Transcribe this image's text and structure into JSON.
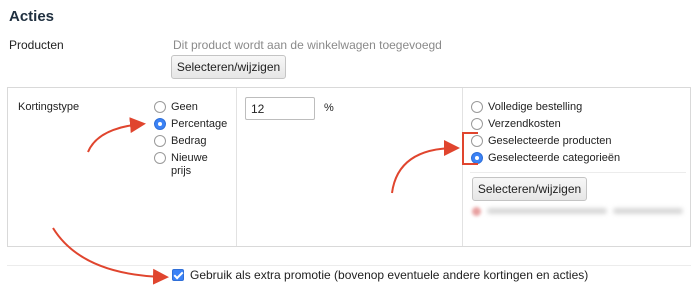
{
  "section_title": "Acties",
  "products": {
    "label": "Producten",
    "note": "Dit product wordt aan de winkelwagen toegevoegd",
    "button_label": "Selecteren/wijzigen"
  },
  "discount": {
    "label": "Kortingstype",
    "type_options": [
      {
        "label": "Geen",
        "checked": false
      },
      {
        "label": "Percentage",
        "checked": true
      },
      {
        "label": "Bedrag",
        "checked": false
      },
      {
        "label": "Nieuwe prijs",
        "checked": false
      }
    ],
    "value": "12",
    "unit": "%",
    "scope_options": [
      {
        "label": "Volledige bestelling",
        "checked": false
      },
      {
        "label": "Verzendkosten",
        "checked": false
      },
      {
        "label": "Geselecteerde producten",
        "checked": false
      },
      {
        "label": "Geselecteerde categorieën",
        "checked": true
      }
    ],
    "scope_button_label": "Selecteren/wijzigen"
  },
  "extra_promotion": {
    "checked": true,
    "label": "Gebruik als extra promotie (bovenop eventuele andere kortingen en acties)"
  },
  "colors": {
    "accent": "#3b82f6",
    "annotation": "#e0452e"
  }
}
